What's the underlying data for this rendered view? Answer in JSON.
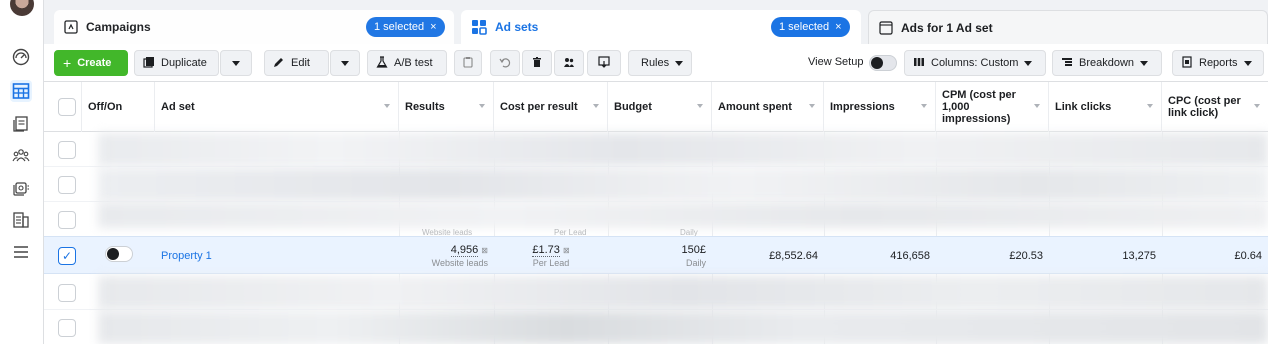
{
  "tabs": {
    "campaigns": {
      "label": "Campaigns",
      "selected": "1 selected"
    },
    "adsets": {
      "label": "Ad sets",
      "selected": "1 selected"
    },
    "ads": {
      "label": "Ads for 1 Ad set"
    },
    "close_glyph": "×"
  },
  "toolbar": {
    "create": "Create",
    "create_icon": "+",
    "duplicate": "Duplicate",
    "edit": "Edit",
    "ab_test": "A/B test",
    "rules": "Rules",
    "view_setup": "View Setup",
    "columns": "Columns: Custom",
    "breakdown": "Breakdown",
    "reports": "Reports"
  },
  "columns": {
    "off_on": "Off/On",
    "ad_set": "Ad set",
    "results": "Results",
    "cost_per_result": "Cost per result",
    "budget": "Budget",
    "amount_spent": "Amount spent",
    "impressions": "Impressions",
    "cpm": "CPM (cost per 1,000 impressions)",
    "link_clicks": "Link clicks",
    "cpc": "CPC (cost per link click)"
  },
  "partial_row": {
    "results_sub": "Website leads",
    "cpr_sub": "Per Lead",
    "budget_sub": "Daily"
  },
  "selected_row": {
    "name": "Property 1",
    "results": "4,956",
    "results_sub": "Website leads",
    "cost_per_result": "£1.73",
    "cpr_sub": "Per Lead",
    "budget": "150£",
    "budget_sub": "Daily",
    "amount_spent": "£8,552.64",
    "impressions": "416,658",
    "cpm": "£20.53",
    "link_clicks": "13,275",
    "cpc": "£0.64"
  },
  "icons": {
    "row_check": "✓",
    "info_mark": "⊠"
  },
  "colors": {
    "accent": "#1b74e4",
    "create_green": "#42b72a",
    "selected_row": "#eaf3ff"
  }
}
